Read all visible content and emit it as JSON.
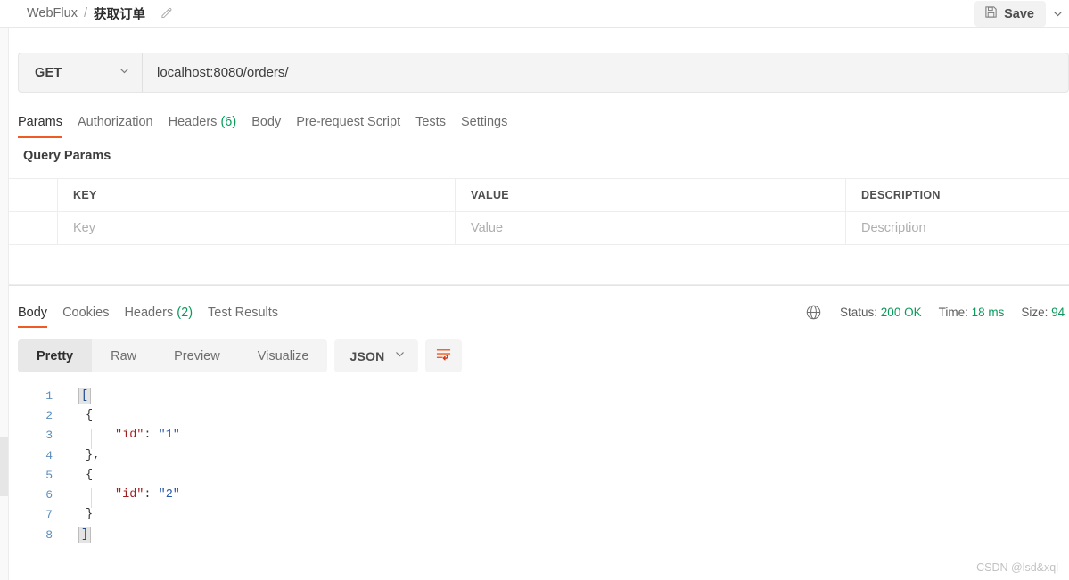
{
  "header": {
    "breadcrumb": {
      "collection": "WebFlux",
      "separator": "/",
      "request_name": "获取订单",
      "edit_icon": "pencil-icon"
    },
    "save": {
      "label": "Save",
      "icon": "floppy-disk-icon",
      "caret_icon": "chevron-down-icon"
    }
  },
  "request": {
    "method": "GET",
    "method_caret_icon": "chevron-down-icon",
    "url": "localhost:8080/orders/",
    "tabs": [
      {
        "label": "Params",
        "active": true,
        "count": ""
      },
      {
        "label": "Authorization",
        "active": false,
        "count": ""
      },
      {
        "label": "Headers",
        "active": false,
        "count": "(6)"
      },
      {
        "label": "Body",
        "active": false,
        "count": ""
      },
      {
        "label": "Pre-request Script",
        "active": false,
        "count": ""
      },
      {
        "label": "Tests",
        "active": false,
        "count": ""
      },
      {
        "label": "Settings",
        "active": false,
        "count": ""
      }
    ]
  },
  "query_params": {
    "section_title": "Query Params",
    "columns": [
      "KEY",
      "VALUE",
      "DESCRIPTION"
    ],
    "placeholder_row": {
      "key": "Key",
      "value": "Value",
      "description": "Description"
    }
  },
  "response": {
    "tabs": [
      {
        "label": "Body",
        "active": true,
        "count": ""
      },
      {
        "label": "Cookies",
        "active": false,
        "count": ""
      },
      {
        "label": "Headers",
        "active": false,
        "count": "(2)"
      },
      {
        "label": "Test Results",
        "active": false,
        "count": ""
      }
    ],
    "status": {
      "globe_icon": "globe-icon",
      "status_label": "Status:",
      "status_value": "200 OK",
      "time_label": "Time:",
      "time_value": "18 ms",
      "size_label": "Size:",
      "size_value": "94"
    },
    "format_tabs": [
      {
        "label": "Pretty",
        "active": true
      },
      {
        "label": "Raw",
        "active": false
      },
      {
        "label": "Preview",
        "active": false
      },
      {
        "label": "Visualize",
        "active": false
      }
    ],
    "language": "JSON",
    "language_caret_icon": "chevron-down-icon",
    "wrap_icon": "word-wrap-icon",
    "body_lines": [
      {
        "num": "1",
        "type": "bracket_open",
        "text": "["
      },
      {
        "num": "2",
        "type": "brace_open",
        "text": "{"
      },
      {
        "num": "3",
        "type": "kv",
        "key": "\"id\"",
        "punc": ": ",
        "value": "\"1\""
      },
      {
        "num": "4",
        "type": "brace_close",
        "text": "},"
      },
      {
        "num": "5",
        "type": "brace_open",
        "text": "{"
      },
      {
        "num": "6",
        "type": "kv",
        "key": "\"id\"",
        "punc": ": ",
        "value": "\"2\""
      },
      {
        "num": "7",
        "type": "brace_close",
        "text": "}"
      },
      {
        "num": "8",
        "type": "bracket_close",
        "text": "]"
      }
    ]
  },
  "watermark": "CSDN @lsd&xql",
  "colors": {
    "accent_orange": "#ef5b25",
    "status_green": "#0b9a5b",
    "json_key": "#9e1f1f",
    "json_string": "#2a55a8",
    "line_number": "#5b8dbd"
  }
}
